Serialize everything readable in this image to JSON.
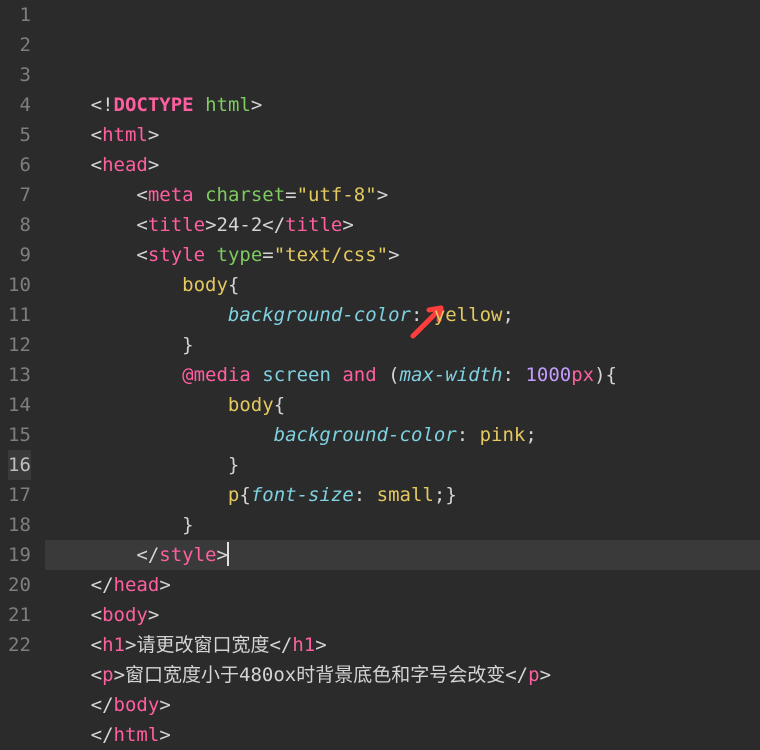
{
  "editor": {
    "highlighted_line": 16,
    "line_count": 22,
    "lines": [
      {
        "n": 1,
        "segs": [
          [
            "p",
            "    "
          ],
          [
            "punct",
            "<!"
          ],
          [
            "doctype",
            "DOCTYPE"
          ],
          [
            "p",
            " "
          ],
          [
            "attr",
            "html"
          ],
          [
            "punct",
            ">"
          ]
        ]
      },
      {
        "n": 2,
        "segs": [
          [
            "p",
            "    "
          ],
          [
            "punct",
            "<"
          ],
          [
            "tag",
            "html"
          ],
          [
            "punct",
            ">"
          ]
        ]
      },
      {
        "n": 3,
        "segs": [
          [
            "p",
            "    "
          ],
          [
            "punct",
            "<"
          ],
          [
            "tag",
            "head"
          ],
          [
            "punct",
            ">"
          ]
        ]
      },
      {
        "n": 4,
        "segs": [
          [
            "p",
            "        "
          ],
          [
            "punct",
            "<"
          ],
          [
            "tag",
            "meta"
          ],
          [
            "p",
            " "
          ],
          [
            "attr",
            "charset"
          ],
          [
            "punct",
            "="
          ],
          [
            "string",
            "\"utf-8\""
          ],
          [
            "punct",
            ">"
          ]
        ]
      },
      {
        "n": 5,
        "segs": [
          [
            "p",
            "        "
          ],
          [
            "punct",
            "<"
          ],
          [
            "tag",
            "title"
          ],
          [
            "punct",
            ">"
          ],
          [
            "text",
            "24-2"
          ],
          [
            "punct",
            "</"
          ],
          [
            "tag",
            "title"
          ],
          [
            "punct",
            ">"
          ]
        ]
      },
      {
        "n": 6,
        "segs": [
          [
            "p",
            "        "
          ],
          [
            "punct",
            "<"
          ],
          [
            "tag",
            "style"
          ],
          [
            "p",
            " "
          ],
          [
            "attr",
            "type"
          ],
          [
            "punct",
            "="
          ],
          [
            "string",
            "\"text/css\""
          ],
          [
            "punct",
            ">"
          ]
        ]
      },
      {
        "n": 7,
        "segs": [
          [
            "p",
            "            "
          ],
          [
            "sel",
            "body"
          ],
          [
            "brace",
            "{"
          ]
        ]
      },
      {
        "n": 8,
        "segs": [
          [
            "p",
            "                "
          ],
          [
            "prop",
            "background-color"
          ],
          [
            "semi",
            ": "
          ],
          [
            "cssval",
            "yellow"
          ],
          [
            "semi",
            ";"
          ]
        ]
      },
      {
        "n": 9,
        "segs": [
          [
            "p",
            "            "
          ],
          [
            "brace",
            "}"
          ]
        ]
      },
      {
        "n": 10,
        "segs": [
          [
            "p",
            "            "
          ],
          [
            "atkw",
            "@media"
          ],
          [
            "p",
            " "
          ],
          [
            "mediakw",
            "screen"
          ],
          [
            "p",
            " "
          ],
          [
            "and",
            "and"
          ],
          [
            "p",
            " "
          ],
          [
            "paren",
            "("
          ],
          [
            "feat",
            "max-width"
          ],
          [
            "semi",
            ": "
          ],
          [
            "num",
            "1000"
          ],
          [
            "unit",
            "px"
          ],
          [
            "paren",
            ")"
          ],
          [
            "brace",
            "{"
          ]
        ]
      },
      {
        "n": 11,
        "segs": [
          [
            "p",
            "                "
          ],
          [
            "sel",
            "body"
          ],
          [
            "brace",
            "{"
          ]
        ]
      },
      {
        "n": 12,
        "segs": [
          [
            "p",
            "                    "
          ],
          [
            "prop",
            "background-color"
          ],
          [
            "semi",
            ": "
          ],
          [
            "cssval",
            "pink"
          ],
          [
            "semi",
            ";"
          ]
        ]
      },
      {
        "n": 13,
        "segs": [
          [
            "p",
            "                "
          ],
          [
            "brace",
            "}"
          ]
        ]
      },
      {
        "n": 14,
        "segs": [
          [
            "p",
            "                "
          ],
          [
            "sel",
            "p"
          ],
          [
            "brace",
            "{"
          ],
          [
            "prop",
            "font-size"
          ],
          [
            "semi",
            ": "
          ],
          [
            "cssval",
            "small"
          ],
          [
            "semi",
            ";"
          ],
          [
            "brace",
            "}"
          ]
        ]
      },
      {
        "n": 15,
        "segs": [
          [
            "p",
            "            "
          ],
          [
            "brace",
            "}"
          ]
        ]
      },
      {
        "n": 16,
        "segs": [
          [
            "p",
            "        "
          ],
          [
            "punct",
            "</"
          ],
          [
            "tag",
            "style"
          ],
          [
            "punct",
            ">"
          ]
        ],
        "cursor": true,
        "hl": true
      },
      {
        "n": 17,
        "segs": [
          [
            "p",
            "    "
          ],
          [
            "punct",
            "</"
          ],
          [
            "tag",
            "head"
          ],
          [
            "punct",
            ">"
          ]
        ]
      },
      {
        "n": 18,
        "segs": [
          [
            "p",
            "    "
          ],
          [
            "punct",
            "<"
          ],
          [
            "tag",
            "body"
          ],
          [
            "punct",
            ">"
          ]
        ]
      },
      {
        "n": 19,
        "segs": [
          [
            "p",
            "    "
          ],
          [
            "punct",
            "<"
          ],
          [
            "tag",
            "h1"
          ],
          [
            "punct",
            ">"
          ],
          [
            "text",
            "请更改窗口宽度"
          ],
          [
            "punct",
            "</"
          ],
          [
            "tag",
            "h1"
          ],
          [
            "punct",
            ">"
          ]
        ]
      },
      {
        "n": 20,
        "segs": [
          [
            "p",
            "    "
          ],
          [
            "punct",
            "<"
          ],
          [
            "tag",
            "p"
          ],
          [
            "punct",
            ">"
          ],
          [
            "text",
            "窗口宽度小于480ox时背景底色和字号会改变"
          ],
          [
            "punct",
            "</"
          ],
          [
            "tag",
            "p"
          ],
          [
            "punct",
            ">"
          ]
        ]
      },
      {
        "n": 21,
        "segs": [
          [
            "p",
            "    "
          ],
          [
            "punct",
            "</"
          ],
          [
            "tag",
            "body"
          ],
          [
            "punct",
            ">"
          ]
        ]
      },
      {
        "n": 22,
        "segs": [
          [
            "p",
            "    "
          ],
          [
            "punct",
            "</"
          ],
          [
            "tag",
            "html"
          ],
          [
            "punct",
            ">"
          ]
        ]
      }
    ]
  }
}
